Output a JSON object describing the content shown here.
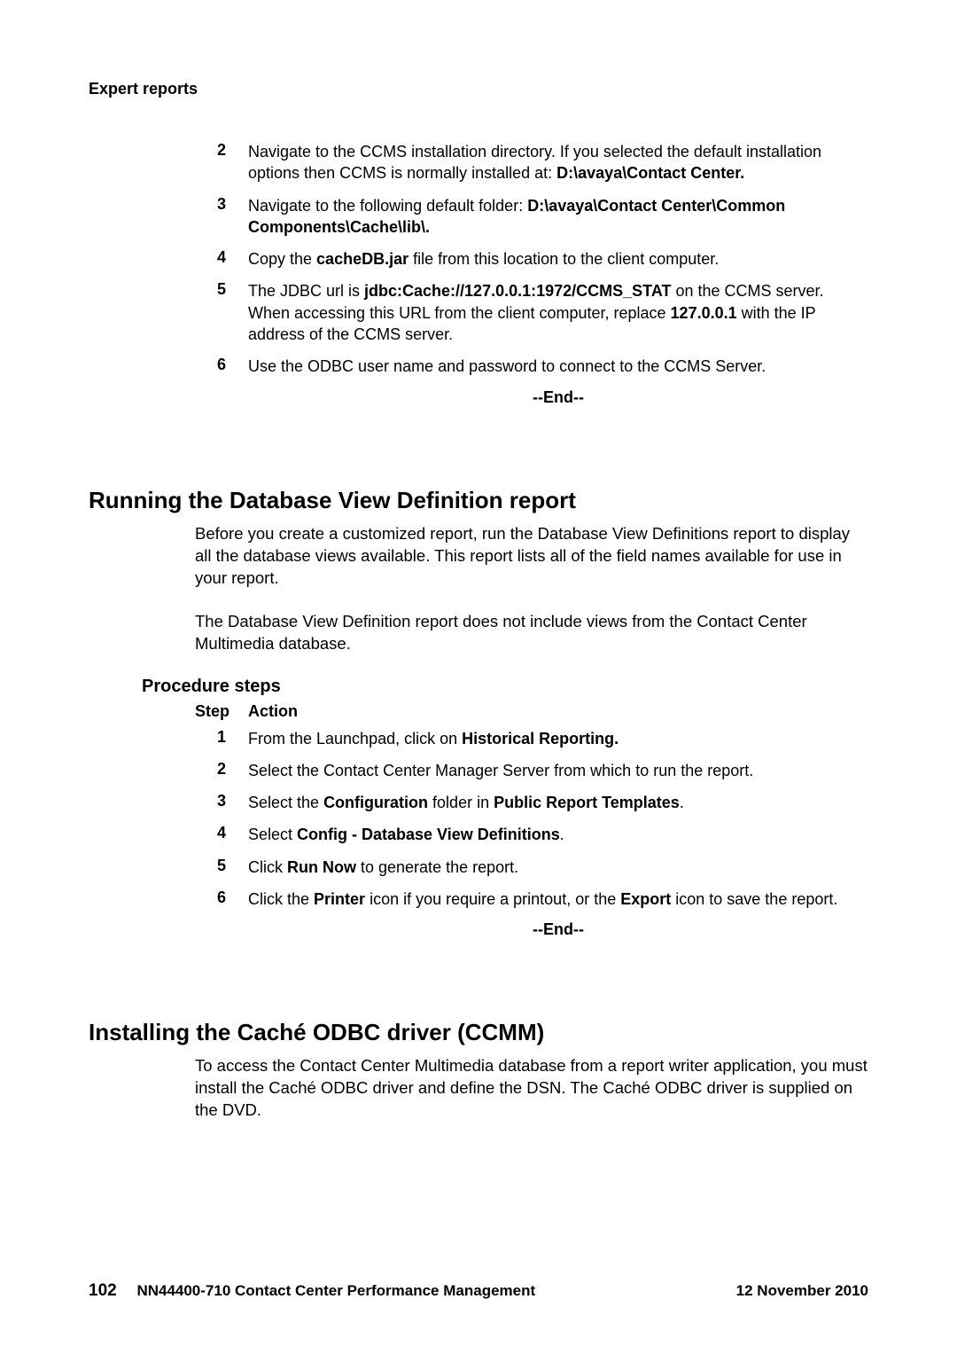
{
  "header": {
    "section_label": "Expert reports"
  },
  "steps_a": {
    "rows": [
      {
        "num": "2",
        "text_before": "Navigate to the CCMS installation directory. If you selected the default installation options then CCMS is normally installed at: ",
        "bold": "D:\\avaya\\Contact Center.",
        "text_after": ""
      },
      {
        "num": "3",
        "text_before": "Navigate to the following default folder: ",
        "bold": "D:\\avaya\\Contact Center\\Common Components\\Cache\\lib\\.",
        "text_after": ""
      },
      {
        "num": "4",
        "text_before": "Copy the ",
        "bold": "cacheDB.jar",
        "text_after": " file from this location to the client computer."
      },
      {
        "num": "5",
        "text_before": "The JDBC url is ",
        "bold": "jdbc:Cache://127.0.0.1:1972/CCMS_STAT",
        "text_mid": " on the CCMS server. When accessing this URL from the client computer, replace ",
        "bold2": "127.0.0.1",
        "text_after": " with the IP address of the CCMS server."
      },
      {
        "num": "6",
        "text_before": "Use the ODBC user name and password to connect to the CCMS Server.",
        "bold": "",
        "text_after": ""
      }
    ],
    "end": "--End--"
  },
  "section_b": {
    "title": "Running the Database View Definition report",
    "para1": "Before you create a customized report, run the Database View Definitions report to display all the database views available. This report lists all of the field names available for use in your report.",
    "para2": "The Database View Definition report does not include views from the Contact Center Multimedia database.",
    "procedure_label": "Procedure steps",
    "header_step": "Step",
    "header_action": "Action",
    "rows": [
      {
        "num": "1",
        "text_before": "From the Launchpad, click on ",
        "bold": "Historical Reporting.",
        "text_after": ""
      },
      {
        "num": "2",
        "text_before": "Select the Contact Center Manager Server from which to run the report.",
        "bold": "",
        "text_after": ""
      },
      {
        "num": "3",
        "text_before": "Select the ",
        "bold": "Configuration",
        "text_mid": " folder in ",
        "bold2": "Public Report Templates",
        "text_after": "."
      },
      {
        "num": "4",
        "text_before": "Select ",
        "bold": "Config - Database View Definitions",
        "text_after": "."
      },
      {
        "num": "5",
        "text_before": "Click ",
        "bold": "Run Now",
        "text_after": " to generate the report."
      },
      {
        "num": "6",
        "text_before": "Click the ",
        "bold": "Printer",
        "text_mid": " icon if you require a printout, or the ",
        "bold2": "Export",
        "text_after": " icon to save the report."
      }
    ],
    "end": "--End--"
  },
  "section_c": {
    "title": "Installing the Caché ODBC driver (CCMM)",
    "para1": "To access the Contact Center Multimedia database from a report writer application, you must install the Caché ODBC driver and define the DSN. The Caché ODBC driver is supplied on the DVD."
  },
  "footer": {
    "page_num": "102",
    "doc_title": "NN44400-710 Contact Center Performance Management",
    "date": "12 November 2010"
  }
}
